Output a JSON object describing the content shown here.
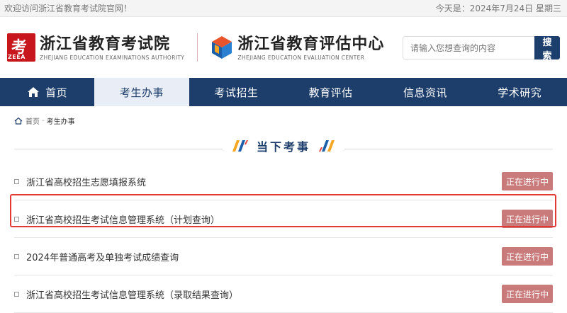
{
  "topbar": {
    "welcome": "欢迎访问浙江省教育考试院官网！",
    "date": "今天是：2024年7月24日 星期三"
  },
  "header": {
    "logo1_badge": "ZEEA",
    "logo1_glyph": "考",
    "logo1_cn": "浙江省教育考试院",
    "logo1_en": "ZHEJIANG EDUCATION EXAMINATIONS AUTHORITY",
    "logo2_cn": "浙江省教育评估中心",
    "logo2_en": "ZHEJIANG EDUCATION EVALUATION CENTER"
  },
  "search": {
    "placeholder": "请输入您想查询的内容",
    "button": "搜索"
  },
  "nav": {
    "items": [
      "首页",
      "考生办事",
      "考试招生",
      "教育评估",
      "信息资讯",
      "学术研究"
    ]
  },
  "breadcrumb": {
    "home": "首页",
    "sep": "-",
    "current": "考生办事"
  },
  "section": {
    "title": "当下考事"
  },
  "list": [
    {
      "text": "浙江省高校招生志愿填报系统",
      "status": "正在进行中"
    },
    {
      "text": "浙江省高校招生考试信息管理系统（计划查询）",
      "status": "正在进行中"
    },
    {
      "text": "2024年普通高考及单独考试成绩查询",
      "status": "正在进行中"
    },
    {
      "text": "浙江省高校招生考试信息管理系统（录取结果查询）",
      "status": "正在进行中"
    }
  ],
  "colors": {
    "nav_bg": "#1d3d6b",
    "status_bg": "#c97b7b",
    "highlight": "#e53935",
    "brand_red": "#c8161d"
  }
}
